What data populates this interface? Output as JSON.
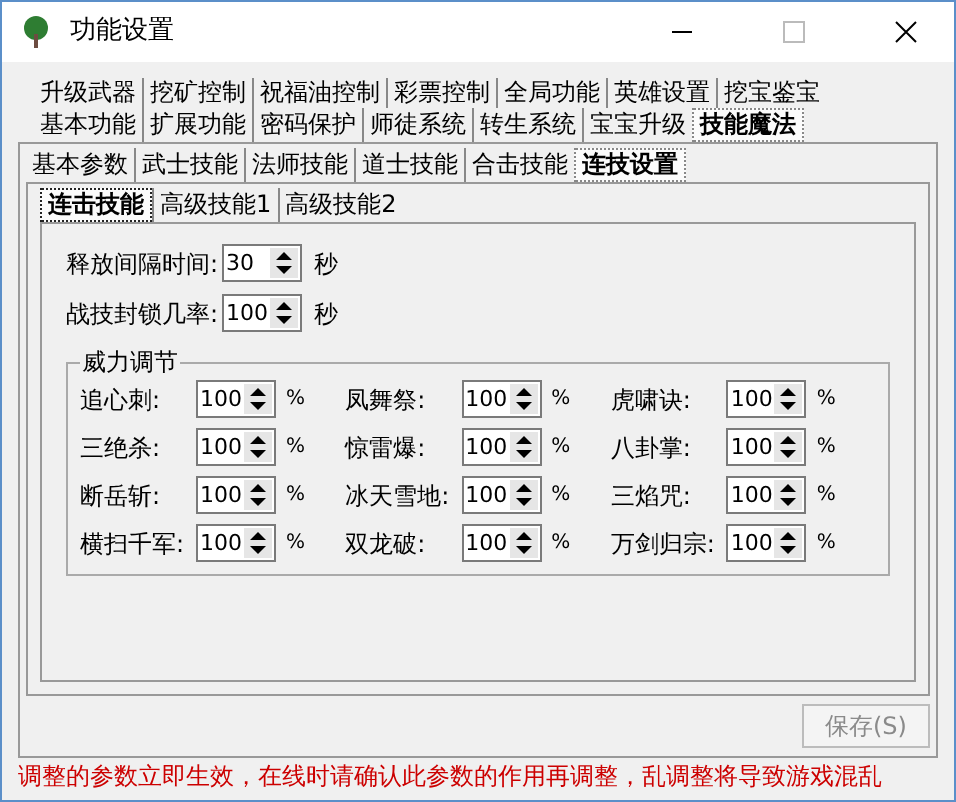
{
  "window": {
    "title": "功能设置"
  },
  "tab_rows": [
    [
      {
        "label": "升级武器",
        "selected": false
      },
      {
        "label": "挖矿控制",
        "selected": false
      },
      {
        "label": "祝福油控制",
        "selected": false
      },
      {
        "label": "彩票控制",
        "selected": false
      },
      {
        "label": "全局功能",
        "selected": false
      },
      {
        "label": "英雄设置",
        "selected": false
      },
      {
        "label": "挖宝鉴宝",
        "selected": false
      }
    ],
    [
      {
        "label": "基本功能",
        "selected": false
      },
      {
        "label": "扩展功能",
        "selected": false
      },
      {
        "label": "密码保护",
        "selected": false
      },
      {
        "label": "师徒系统",
        "selected": false
      },
      {
        "label": "转生系统",
        "selected": false
      },
      {
        "label": "宝宝升级",
        "selected": false
      },
      {
        "label": "技能魔法",
        "selected": true
      }
    ]
  ],
  "sub_tabs": [
    {
      "label": "基本参数",
      "selected": false
    },
    {
      "label": "武士技能",
      "selected": false
    },
    {
      "label": "法师技能",
      "selected": false
    },
    {
      "label": "道士技能",
      "selected": false
    },
    {
      "label": "合击技能",
      "selected": false
    },
    {
      "label": "连技设置",
      "selected": true
    }
  ],
  "inner_tabs": [
    {
      "label": "连击技能",
      "selected": true
    },
    {
      "label": "高级技能1",
      "selected": false
    },
    {
      "label": "高级技能2",
      "selected": false
    }
  ],
  "settings": [
    {
      "label": "释放间隔时间:",
      "value": "30",
      "unit": "秒"
    },
    {
      "label": "战技封锁几率:",
      "value": "100",
      "unit": "秒"
    }
  ],
  "power_group": {
    "title": "威力调节",
    "items": [
      {
        "label": "追心刺:",
        "value": "100",
        "unit": "%"
      },
      {
        "label": "凤舞祭:",
        "value": "100",
        "unit": "%"
      },
      {
        "label": "虎啸诀:",
        "value": "100",
        "unit": "%"
      },
      {
        "label": "三绝杀:",
        "value": "100",
        "unit": "%"
      },
      {
        "label": "惊雷爆:",
        "value": "100",
        "unit": "%"
      },
      {
        "label": "八卦掌:",
        "value": "100",
        "unit": "%"
      },
      {
        "label": "断岳斩:",
        "value": "100",
        "unit": "%"
      },
      {
        "label": "冰天雪地:",
        "value": "100",
        "unit": "%"
      },
      {
        "label": "三焰咒:",
        "value": "100",
        "unit": "%"
      },
      {
        "label": "横扫千军:",
        "value": "100",
        "unit": "%"
      },
      {
        "label": "双龙破:",
        "value": "100",
        "unit": "%"
      },
      {
        "label": "万剑归宗:",
        "value": "100",
        "unit": "%"
      }
    ]
  },
  "save_button": {
    "label": "保存(S)",
    "disabled": true
  },
  "warning": "调整的参数立即生效，在线时请确认此参数的作用再调整，乱调整将导致游戏混乱"
}
